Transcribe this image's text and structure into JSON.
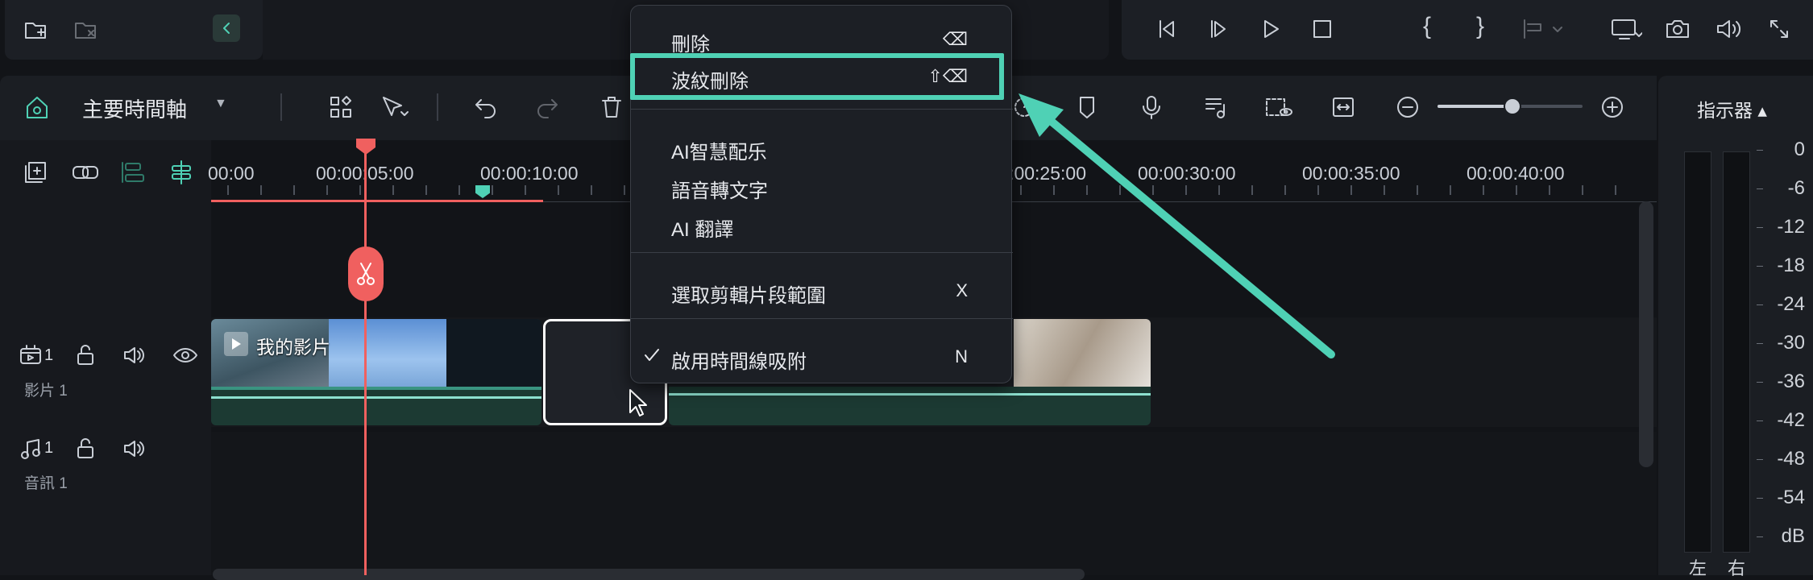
{
  "colors": {
    "accent": "#4fd1b5",
    "playhead": "#f0605f",
    "highlight": "#4fd1b5",
    "bg": "#121418",
    "panel": "#1c1f25"
  },
  "timeline": {
    "name": "主要時間軸",
    "ruler": [
      "00:00",
      "00:00:05:00",
      "00:00:10:00",
      "00:00:25:00",
      "00:00:30:00",
      "00:00:35:00",
      "00:00:40:00"
    ]
  },
  "tracks": {
    "video": {
      "num": "1",
      "name": "影片 1",
      "clip_title": "我的影片"
    },
    "audio": {
      "num": "1",
      "name": "音訊 1"
    }
  },
  "context_menu": {
    "items": [
      {
        "label": "刪除",
        "shortcut": "⌫"
      },
      {
        "label": "波紋刪除",
        "shortcut": "⇧⌫"
      },
      {
        "label": "AI智慧配乐",
        "shortcut": ""
      },
      {
        "label": "語音轉文字",
        "shortcut": ""
      },
      {
        "label": "AI 翻譯",
        "shortcut": ""
      },
      {
        "label": "選取剪輯片段範圍",
        "shortcut": "X"
      },
      {
        "label": "啟用時間線吸附",
        "shortcut": "N",
        "checked": true
      }
    ]
  },
  "meter": {
    "title": "指示器 ▴",
    "scale": [
      "0",
      "-6",
      "-12",
      "-18",
      "-24",
      "-30",
      "-36",
      "-42",
      "-48",
      "-54",
      "dB"
    ],
    "left": "左",
    "right": "右"
  },
  "icons": [
    "new-folder-icon",
    "delete-folder-icon",
    "collapse-left-icon",
    "prev-frame-icon",
    "next-frame-icon",
    "play-icon",
    "stop-icon",
    "mark-in-icon",
    "mark-out-icon",
    "insert-icon",
    "display-icon",
    "snapshot-icon",
    "volume-icon",
    "fullscreen-icon",
    "home-icon",
    "dropdown-icon",
    "grid-icon",
    "select-tool-icon",
    "undo-icon",
    "redo-icon",
    "trash-icon",
    "speed-icon",
    "marker-icon",
    "mic-icon",
    "audio-list-icon",
    "preview-icon",
    "fit-icon",
    "zoom-out-icon",
    "zoom-in-icon",
    "add-track-icon",
    "link-icon",
    "group-icon",
    "snap-icon",
    "scissors-icon",
    "lock-icon",
    "speaker-icon",
    "eye-icon",
    "check-icon",
    "cursor-icon"
  ]
}
